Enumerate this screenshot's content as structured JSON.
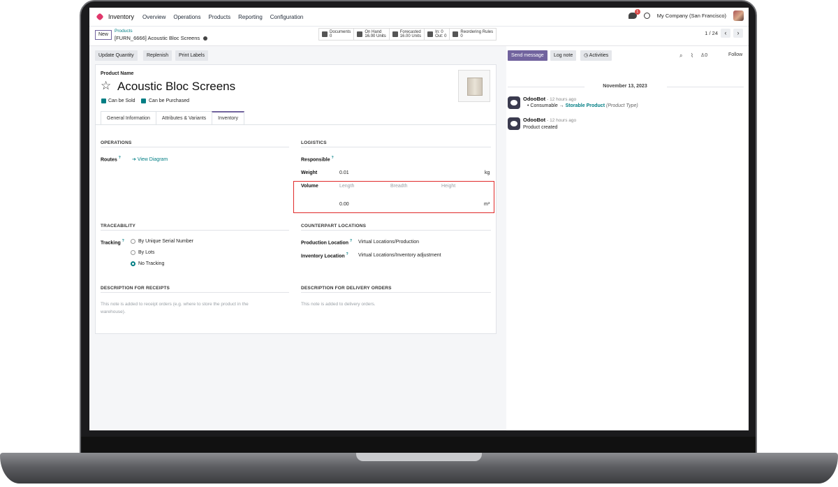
{
  "navbar": {
    "app_name": "Inventory",
    "menu": [
      "Overview",
      "Operations",
      "Products",
      "Reporting",
      "Configuration"
    ],
    "chat_badge": "1",
    "company": "My Company (San Francisco)"
  },
  "control": {
    "new_label": "New",
    "breadcrumb_parent": "Products",
    "breadcrumb_current": "[FURN_6666] Acoustic Bloc Screens",
    "smart_buttons": [
      {
        "line1": "Documents",
        "line2": "0"
      },
      {
        "line1": "On Hand",
        "line2": "16.00 Units"
      },
      {
        "line1": "Forecasted",
        "line2": "16.00 Units"
      },
      {
        "line1": "In: 0",
        "line2": "Out: 0"
      },
      {
        "line1": "Reordering Rules",
        "line2": "0"
      }
    ],
    "pager": "1 / 24"
  },
  "actions": {
    "update_quantity": "Update Quantity",
    "replenish": "Replenish",
    "print_labels": "Print Labels"
  },
  "product": {
    "name_label": "Product Name",
    "name": "Acoustic Bloc Screens",
    "can_be_sold": "Can be Sold",
    "can_be_purchased": "Can be Purchased"
  },
  "tabs": [
    "General Information",
    "Attributes & Variants",
    "Inventory"
  ],
  "inventory": {
    "operations_title": "OPERATIONS",
    "routes_label": "Routes",
    "view_diagram": "View Diagram",
    "logistics_title": "LOGISTICS",
    "responsible_label": "Responsible",
    "weight_label": "Weight",
    "weight_value": "0.01",
    "weight_unit": "kg",
    "volume_label": "Volume",
    "length_placeholder": "Length",
    "breadth_placeholder": "Breadth",
    "height_placeholder": "Height",
    "volume_value": "0.00",
    "volume_unit": "m³",
    "traceability_title": "TRACEABILITY",
    "tracking_label": "Tracking",
    "tracking_options": [
      "By Unique Serial Number",
      "By Lots",
      "No Tracking"
    ],
    "counterpart_title": "COUNTERPART LOCATIONS",
    "production_location_label": "Production Location",
    "production_location_value": "Virtual Locations/Production",
    "inventory_location_label": "Inventory Location",
    "inventory_location_value": "Virtual Locations/Inventory adjustment",
    "receipts_title": "DESCRIPTION FOR RECEIPTS",
    "receipts_placeholder_1": "This note is added to receipt orders (e.g. where to store the product in the",
    "receipts_placeholder_2": "warehouse).",
    "delivery_title": "DESCRIPTION FOR DELIVERY ORDERS",
    "delivery_placeholder": "This note is added to delivery orders."
  },
  "chatter": {
    "send_message": "Send message",
    "log_note": "Log note",
    "activities": "Activities",
    "followers_count": "0",
    "follow": "Follow",
    "date": "November 13, 2023",
    "messages": [
      {
        "author": "OdooBot",
        "time": "- 12 hours ago",
        "old": "Consumable",
        "new": "Storable Product",
        "field": "(Product Type)"
      },
      {
        "author": "OdooBot",
        "time": "- 12 hours ago",
        "body": "Product created"
      }
    ]
  },
  "colors": {
    "primary": "#71639e",
    "teal": "#017e84",
    "highlight_border": "#e02a2a"
  }
}
